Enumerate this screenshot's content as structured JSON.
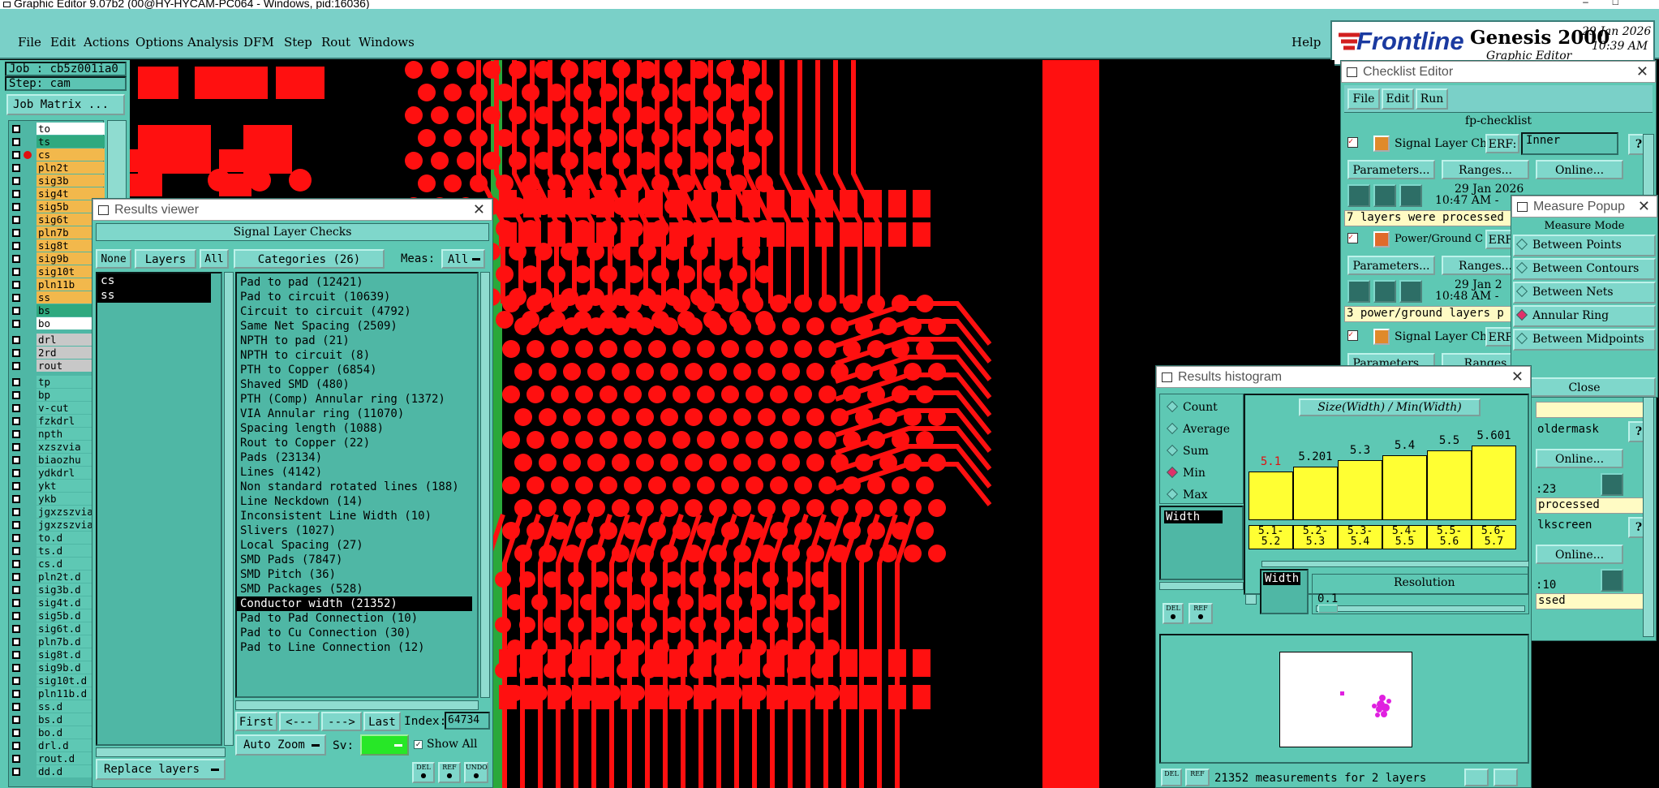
{
  "window_title": "Graphic Editor 9.07b2 (00@HY-HYCAM-PC064 - Windows, pid:16036)",
  "menu": [
    "File",
    "Edit",
    "Actions",
    "Options",
    "Analysis",
    "DFM",
    "Step",
    "Rout",
    "Windows"
  ],
  "help": "Help",
  "brand": {
    "logo": "Frontline",
    "product": "Genesis 2000",
    "subtitle": "Graphic Editor",
    "date": "29 Jan 2026",
    "time": "10:39 AM"
  },
  "job": {
    "job_label": "Job : cb5z001ia0",
    "step_label": "Step: cam",
    "matrix_btn": "Job Matrix ..."
  },
  "layers": [
    "to",
    "ts",
    "cs",
    "pln2t",
    "sig3b",
    "sig4t",
    "sig5b",
    "sig6t",
    "pln7b",
    "sig8t",
    "sig9b",
    "sig10t",
    "pln11b",
    "ss",
    "bs",
    "bo",
    "drl",
    "2rd",
    "rout",
    "tp",
    "bp",
    "v-cut",
    "fzkdrl",
    "npth",
    "xzszvia",
    "biaozhu",
    "ydkdrl",
    "ykt",
    "ykb",
    "jgxzszvia",
    "jgxzszvial",
    "to.d",
    "ts.d",
    "cs.d",
    "pln2t.d",
    "sig3b.d",
    "sig4t.d",
    "sig5b.d",
    "sig6t.d",
    "pln7b.d",
    "sig8t.d",
    "sig9b.d",
    "sig10t.d",
    "pln11b.d",
    "ss.d",
    "bs.d",
    "bo.d",
    "drl.d",
    "rout.d",
    "dd.d"
  ],
  "results_viewer": {
    "title": "Results viewer",
    "header": "Signal Layer Checks",
    "btn_none": "None",
    "btn_layers": "Layers",
    "btn_all": "All",
    "categories_label": "Categories (26)",
    "meas_label": "Meas:",
    "meas_value": "All",
    "sel_layers": [
      "cs",
      "ss"
    ],
    "categories": [
      "Pad to pad (12421)",
      "Pad to circuit (10639)",
      "Circuit to circuit (4792)",
      "Same Net Spacing (2509)",
      "NPTH to pad (21)",
      "NPTH to circuit (8)",
      "PTH to Copper (6854)",
      "Shaved SMD (480)",
      "PTH (Comp) Annular ring (1372)",
      "VIA Annular ring (11070)",
      "Spacing length (1088)",
      "Rout to Copper (22)",
      "Pads (23134)",
      "Lines (4142)",
      "Non standard rotated lines (188)",
      "Line Neckdown (14)",
      "Inconsistent Line Width (10)",
      "Slivers (1027)",
      "Local Spacing (27)",
      "SMD Pads (7847)",
      "SMD Pitch (36)",
      "SMD Packages (528)",
      "Conductor width (21352)",
      "Pad to Pad Connection (10)",
      "Pad to Cu Connection (30)",
      "Pad to Line Connection (12)"
    ],
    "selected_category": "Conductor width (21352)",
    "nav": {
      "first": "First",
      "prev": "<---",
      "next": "--->",
      "last": "Last",
      "index_label": "Index:",
      "index_value": "64734"
    },
    "auto_zoom": "Auto Zoom",
    "sv_label": "Sv:",
    "show_all": "Show All",
    "replace_layers": "Replace layers"
  },
  "checklist": {
    "title": "Checklist Editor",
    "menu": [
      "File",
      "Edit",
      "Run"
    ],
    "name": "fp-checklist",
    "row1": {
      "name": "Signal Layer Ch",
      "erf": "ERF:",
      "erf_val": "Inner",
      "params": "Parameters...",
      "ranges": "Ranges...",
      "online": "Online...",
      "date": "29 Jan 2026",
      "time": "10:47 AM -",
      "status": "7 layers were processed"
    },
    "row2": {
      "name": "Power/Ground C",
      "erf": "ERF:",
      "params": "Parameters...",
      "ranges": "Ranges...",
      "date": "29 Jan 2",
      "time": "10:48 AM -",
      "status": "3 power/ground layers p"
    },
    "row3": {
      "name": "Signal Layer Ch",
      "erf": "ERF:",
      "params": "Parameters...",
      "ranges": "Ranges"
    },
    "side": {
      "a": "oldermask",
      "online1": "Online...",
      "t1": ":23",
      "p1": "processed",
      "b": "lkscreen",
      "online2": "Online...",
      "t2": ":10",
      "p2": "ssed"
    }
  },
  "measure": {
    "title": "Measure Popup",
    "mode": "Measure Mode",
    "options": [
      "Between Points",
      "Between Contours",
      "Between Nets",
      "Annular Ring",
      "Between Midpoints"
    ],
    "selected": "Annular Ring",
    "close": "Close"
  },
  "histogram": {
    "title": "Results histogram",
    "stats": [
      "Count",
      "Average",
      "Sum",
      "Min",
      "Max"
    ],
    "selected_stat": "Min",
    "field": "Width",
    "field2": "Width",
    "graph_title": "Size(Width) / Min(Width)",
    "bars": [
      {
        "v": "5.1",
        "r1": "5.1-",
        "r2": "5.2",
        "h": 0.6
      },
      {
        "v": "5.201",
        "r1": "5.2-",
        "r2": "5.3",
        "h": 0.66
      },
      {
        "v": "5.3",
        "r1": "5.3-",
        "r2": "5.4",
        "h": 0.74
      },
      {
        "v": "5.4",
        "r1": "5.4-",
        "r2": "5.5",
        "h": 0.8
      },
      {
        "v": "5.5",
        "r1": "5.5-",
        "r2": "5.6",
        "h": 0.86
      },
      {
        "v": "5.601",
        "r1": "5.6-",
        "r2": "5.7",
        "h": 0.92
      }
    ],
    "resolution_label": "Resolution",
    "resolution_value": "0.1",
    "status": "21352 measurements for 2 layers",
    "colors": {
      "bar": "#ffff33",
      "min_value": "#e01010"
    }
  },
  "colors": {
    "teal": "#5ec8b4",
    "copper": "#ff1010",
    "brand_red": "#d21f1f",
    "brand_blue": "#1a3aa0"
  }
}
